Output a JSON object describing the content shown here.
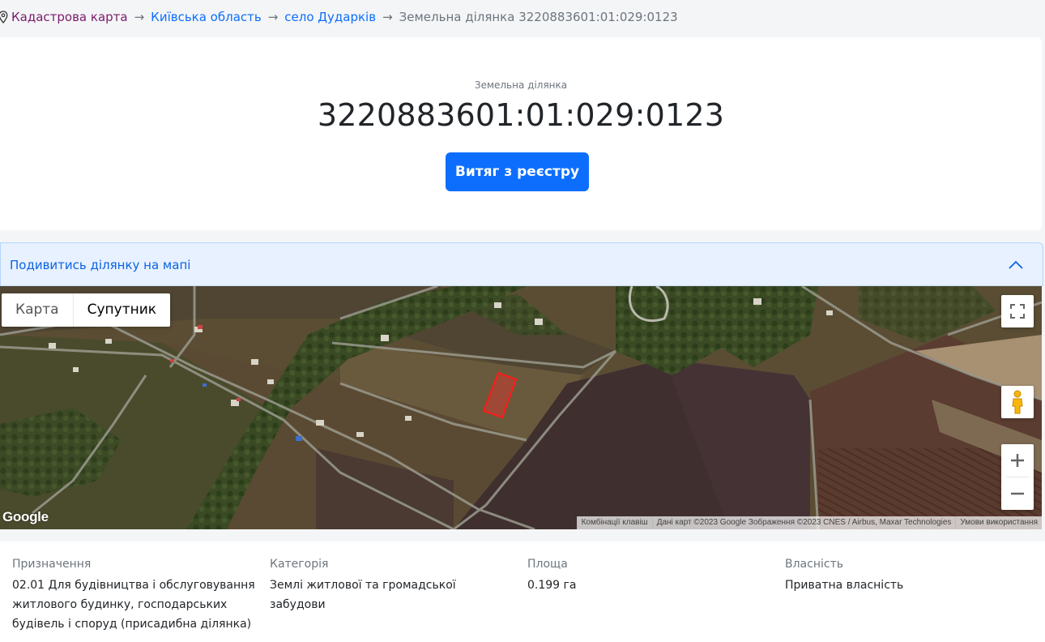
{
  "breadcrumb": {
    "items": [
      "Кадастрова карта",
      "Київська область",
      "село Дударків"
    ],
    "separator": "→",
    "current": "Земельна ділянка 3220883601:01:029:0123"
  },
  "parcel": {
    "label": "Земельна ділянка",
    "cadastral_number": "3220883601:01:029:0123",
    "extract_button": "Витяг з реєстру"
  },
  "map_section": {
    "toggle_label": "Подивитись ділянку на мапі",
    "map_type_tabs": [
      "Карта",
      "Супутник"
    ],
    "active_tab": "Супутник",
    "google_logo": "Google",
    "attribution": [
      "Комбінації клавіш",
      "Дані карт ©2023 Google Зображення ©2023 CNES / Airbus, Maxar Technologies",
      "Умови використання"
    ],
    "zoom_in": "+",
    "zoom_out": "−"
  },
  "details": [
    {
      "key": "Призначення",
      "value": "02.01 Для будівництва і обслуговування житлового будинку, господарських будівель і споруд (присадибна ділянка)"
    },
    {
      "key": "Категорія",
      "value": "Землі житлової та громадської забудови"
    },
    {
      "key": "Площа",
      "value": "0.199 га"
    },
    {
      "key": "Власність",
      "value": "Приватна власність"
    }
  ],
  "colors": {
    "primary": "#0d6efd",
    "visited_link": "#7b1a6b",
    "accordion_bg": "#e7f1ff",
    "parcel_outline": "#ff1a1a"
  }
}
